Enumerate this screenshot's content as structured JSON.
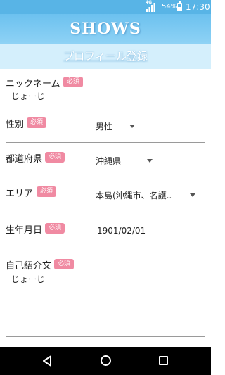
{
  "status_bar": {
    "network": "4G",
    "battery_percent": "54%",
    "battery_level": 0.54,
    "time": "17:30"
  },
  "app": {
    "logo": "SHOWS",
    "page_title": "プロフィール登録"
  },
  "required_badge": "必須",
  "form": {
    "nickname": {
      "label": "ニックネーム",
      "value": "じょーじ"
    },
    "gender": {
      "label": "性別",
      "value": "男性"
    },
    "prefecture": {
      "label": "都道府県",
      "value": "沖縄県"
    },
    "area": {
      "label": "エリア",
      "value": "本島(沖縄市、名護.."
    },
    "birthdate": {
      "label": "生年月日",
      "value": "1901/02/01"
    },
    "bio": {
      "label": "自己紹介文",
      "value": "じょーじ"
    }
  },
  "colors": {
    "status_bar": "#58b4e6",
    "header": "#6cc1ef",
    "subheader": "#d4effc",
    "badge": "#f08aa2"
  },
  "icons": {
    "back": "triangle-back-icon",
    "home": "circle-home-icon",
    "recent": "square-recent-icon"
  }
}
